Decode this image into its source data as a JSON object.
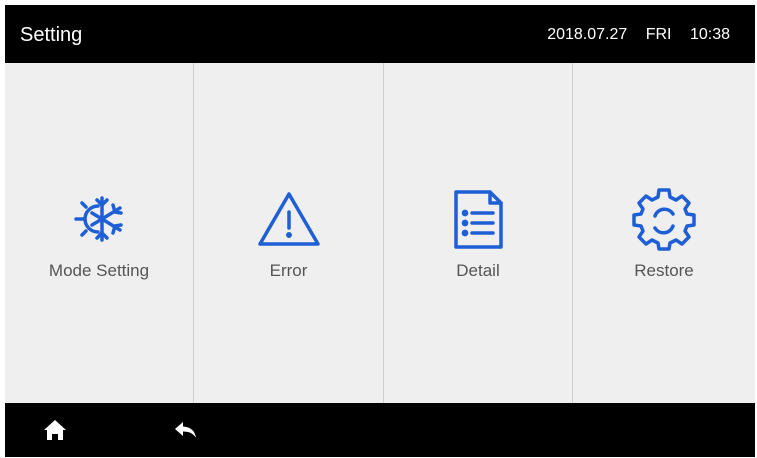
{
  "header": {
    "title": "Setting",
    "date": "2018.07.27",
    "weekday": "FRI",
    "time": "10:38"
  },
  "tiles": [
    {
      "label": "Mode Setting",
      "icon": "snowflake-sun-icon"
    },
    {
      "label": "Error",
      "icon": "warning-triangle-icon"
    },
    {
      "label": "Detail",
      "icon": "document-list-icon"
    },
    {
      "label": "Restore",
      "icon": "gear-icon"
    }
  ],
  "footer": {
    "home_icon": "home-icon",
    "back_icon": "back-arrow-icon"
  },
  "colors": {
    "bar_background": "#000000",
    "panel_background": "#efefef",
    "accent_icon": "#1f5fd6",
    "label_text": "#555555",
    "divider": "#cfcfcf"
  }
}
